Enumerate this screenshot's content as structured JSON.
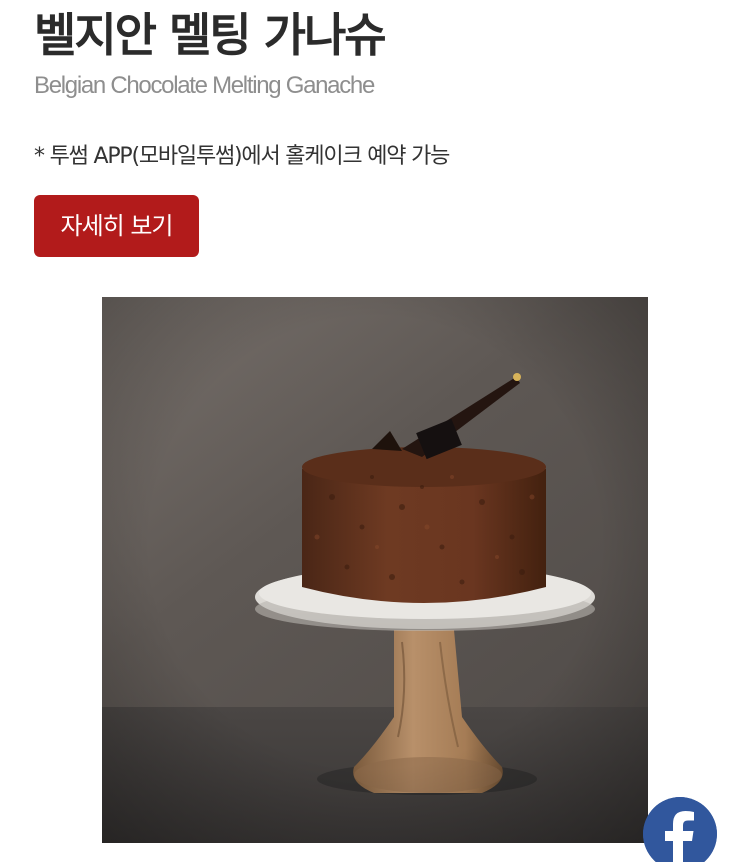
{
  "product": {
    "title": "벨지안 멜팅 가나슈",
    "subtitle": "Belgian Chocolate Melting Ganache",
    "notice": "* 투썸 APP(모바일투썸)에서 홀케이크 예약 가능",
    "detail_button_label": "자세히 보기",
    "image_icon": "chocolate-cake-photo"
  },
  "social": {
    "facebook_icon": "facebook-icon"
  },
  "colors": {
    "button_red": "#b21b1b",
    "facebook_blue": "#31579d",
    "title": "#2b2b2b",
    "subtitle": "#8e8e8e"
  }
}
